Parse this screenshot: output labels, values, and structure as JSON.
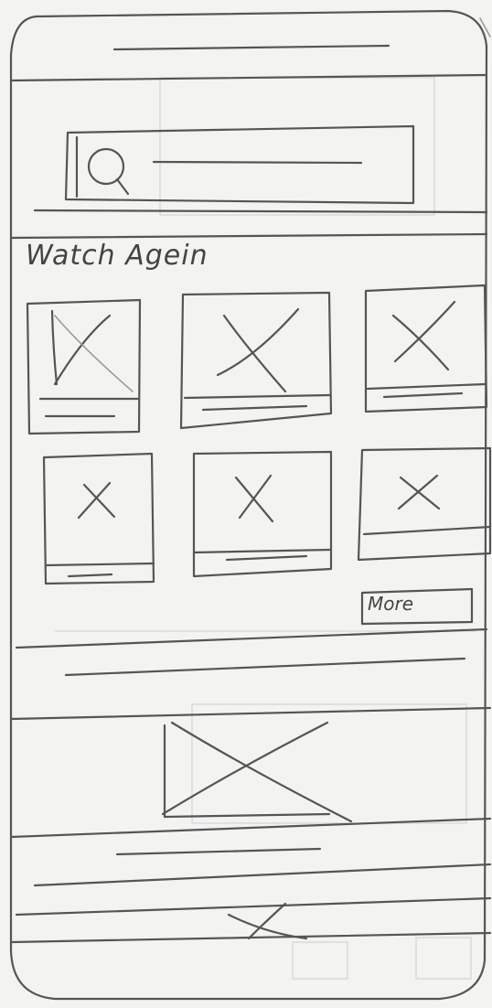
{
  "watch_again": {
    "title": "Watch Agein",
    "more_label": "More"
  },
  "icons": {
    "search": "search-icon",
    "image_placeholder": "image-placeholder-icon"
  }
}
